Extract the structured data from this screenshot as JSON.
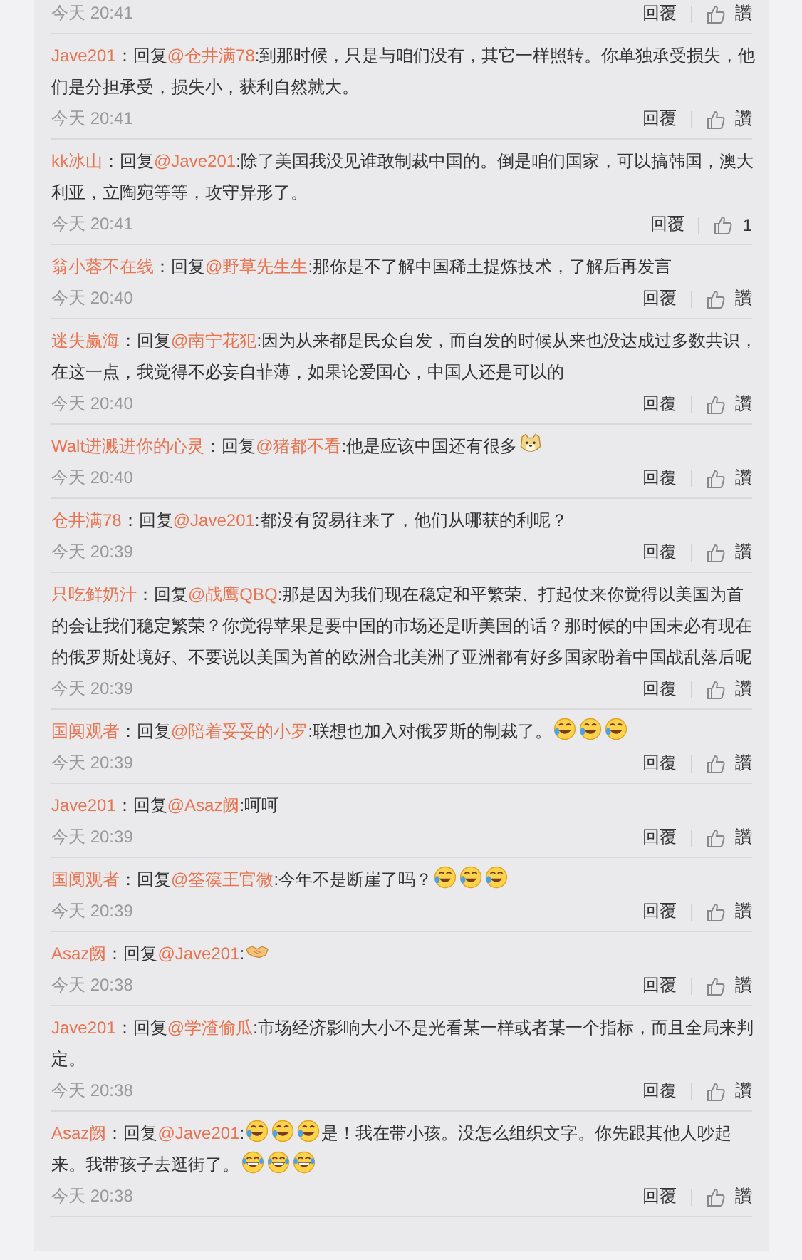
{
  "comments": [
    {
      "time": "今天 20:41",
      "reply": "回覆",
      "like": "讚"
    },
    {
      "author": "Jave201",
      "prefix": "：回复",
      "mention": "@仓井满78",
      "body": [
        {
          "kind": "text",
          "text": ":到那时候，只是与咱们没有，其它一样照转。你单独承受损失，他们是分担承受，损失小，获利自然就大。"
        }
      ],
      "time": "今天 20:41",
      "reply": "回覆",
      "like": "讚"
    },
    {
      "author": "kk冰山",
      "prefix": "：回复",
      "mention": "@Jave201",
      "body": [
        {
          "kind": "text",
          "text": ":除了美国我没见谁敢制裁中国的。倒是咱们国家，可以搞韩国，澳大利亚，立陶宛等等，攻守异形了。"
        }
      ],
      "time": "今天 20:41",
      "reply": "回覆",
      "like": "1"
    },
    {
      "author": "翁小蓉不在线",
      "prefix": "：回复",
      "mention": "@野草先生生",
      "body": [
        {
          "kind": "text",
          "text": ":那你是不了解中国稀土提炼技术，了解后再发言"
        }
      ],
      "time": "今天 20:40",
      "reply": "回覆",
      "like": "讚"
    },
    {
      "author": "迷失赢海",
      "prefix": "：回复",
      "mention": "@南宁花犯",
      "body": [
        {
          "kind": "text",
          "text": ":因为从来都是民众自发，而自发的时候从来也没达成过多数共识，在这一点，我觉得不必妄自菲薄，如果论爱国心，中国人还是可以的"
        }
      ],
      "time": "今天 20:40",
      "reply": "回覆",
      "like": "讚"
    },
    {
      "author": "Walt进溅进你的心灵",
      "prefix": "：回复",
      "mention": "@猪都不看",
      "body": [
        {
          "kind": "text",
          "text": ":他是应该中国还有很多"
        },
        {
          "kind": "dog"
        }
      ],
      "time": "今天 20:40",
      "reply": "回覆",
      "like": "讚"
    },
    {
      "author": "仓井满78",
      "prefix": "：回复",
      "mention": "@Jave201",
      "body": [
        {
          "kind": "text",
          "text": ":都没有贸易往来了，他们从哪获的利呢？"
        }
      ],
      "time": "今天 20:39",
      "reply": "回覆",
      "like": "讚"
    },
    {
      "author": "只吃鲜奶汁",
      "prefix": "：回复",
      "mention": "@战鹰QBQ",
      "body": [
        {
          "kind": "text",
          "text": ":那是因为我们现在稳定和平繁荣、打起仗来你觉得以美国为首的会让我们稳定繁荣？你觉得苹果是要中国的市场还是听美国的话？那时候的中国未必有现在的俄罗斯处境好、不要说以美国为首的欧洲合北美洲了亚洲都有好多国家盼着中国战乱落后呢"
        }
      ],
      "time": "今天 20:39",
      "reply": "回覆",
      "like": "讚"
    },
    {
      "author": "国阒观者",
      "prefix": "：回复",
      "mention": "@陪着妥妥的小罗",
      "body": [
        {
          "kind": "text",
          "text": ":联想也加入对俄罗斯的制裁了。"
        },
        {
          "kind": "laugh_cry"
        },
        {
          "kind": "laugh_cry"
        },
        {
          "kind": "laugh_cry"
        }
      ],
      "time": "今天 20:39",
      "reply": "回覆",
      "like": "讚"
    },
    {
      "author": "Jave201",
      "prefix": "：回复",
      "mention": "@Asaz阙",
      "body": [
        {
          "kind": "text",
          "text": ":呵呵"
        }
      ],
      "time": "今天 20:39",
      "reply": "回覆",
      "like": "讚"
    },
    {
      "author": "国阒观者",
      "prefix": "：回复",
      "mention": "@筌篌王官微",
      "body": [
        {
          "kind": "text",
          "text": ":今年不是断崖了吗？"
        },
        {
          "kind": "laugh_cry"
        },
        {
          "kind": "laugh_cry"
        },
        {
          "kind": "laugh_cry"
        }
      ],
      "time": "今天 20:39",
      "reply": "回覆",
      "like": "讚"
    },
    {
      "author": "Asaz阙",
      "prefix": "：回复",
      "mention": "@Jave201",
      "body": [
        {
          "kind": "text",
          "text": ":"
        },
        {
          "kind": "handshake"
        }
      ],
      "time": "今天 20:38",
      "reply": "回覆",
      "like": "讚"
    },
    {
      "author": "Jave201",
      "prefix": "：回复",
      "mention": "@学渣偷瓜",
      "body": [
        {
          "kind": "text",
          "text": ":市场经济影响大小不是光看某一样或者某一个指标，而且全局来判定。"
        }
      ],
      "time": "今天 20:38",
      "reply": "回覆",
      "like": "讚"
    },
    {
      "author": "Asaz阙",
      "prefix": "：回复",
      "mention": "@Jave201",
      "body": [
        {
          "kind": "text",
          "text": ":"
        },
        {
          "kind": "laugh_cry"
        },
        {
          "kind": "laugh_cry"
        },
        {
          "kind": "laugh_cry"
        },
        {
          "kind": "text",
          "text": "是！我在带小孩。没怎么组织文字。你先跟其他人吵起来。我带孩子去逛街了。"
        },
        {
          "kind": "grin_tears"
        },
        {
          "kind": "grin_tears"
        },
        {
          "kind": "grin_tears"
        }
      ],
      "time": "今天 20:38",
      "reply": "回覆",
      "like": "讚"
    }
  ]
}
